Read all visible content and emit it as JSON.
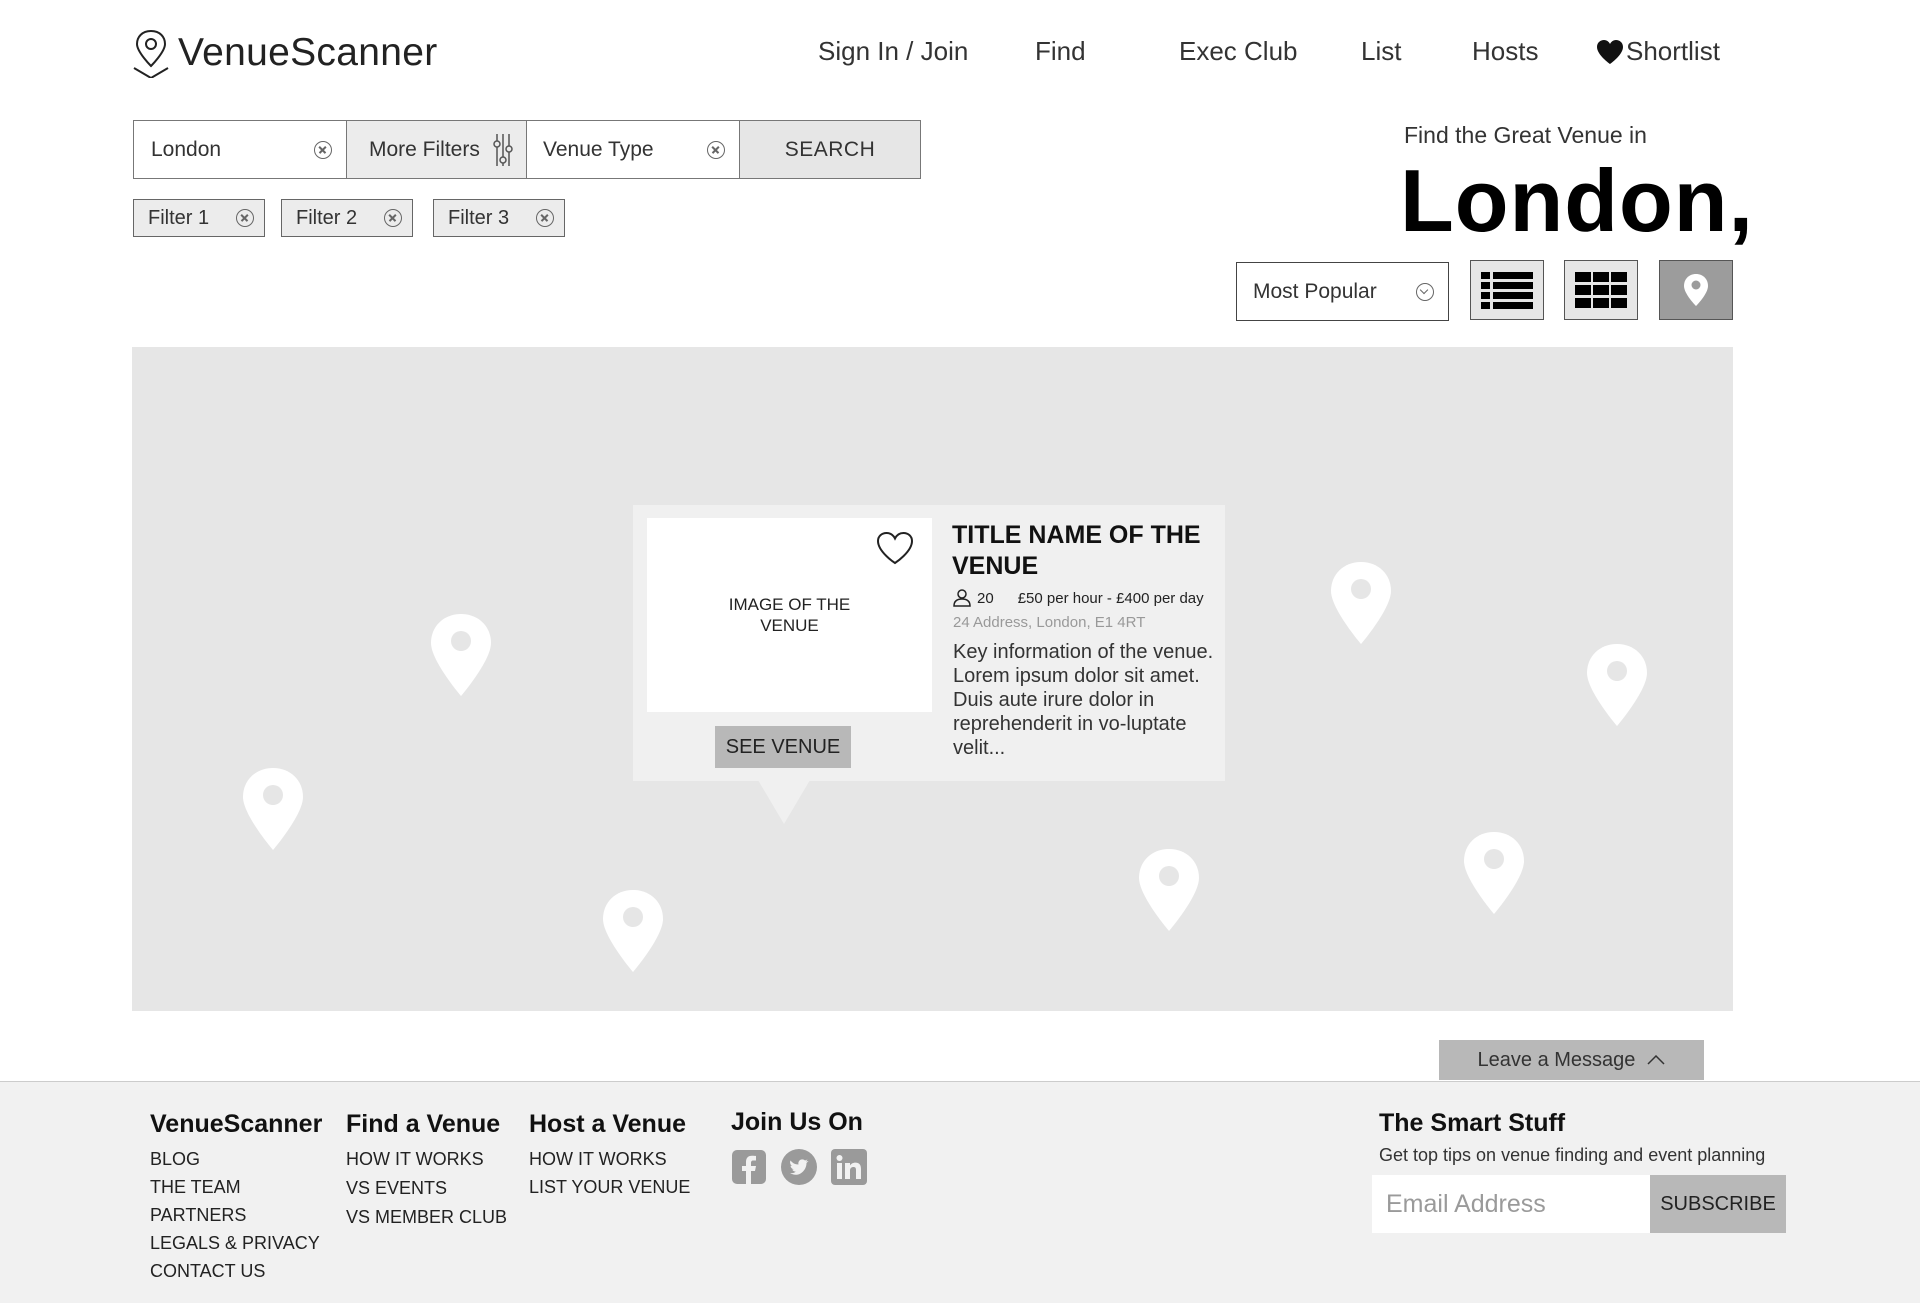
{
  "brand": {
    "name": "VenueScanner",
    "logo_icon": "location-pin-outline-icon"
  },
  "nav": {
    "items": [
      {
        "label": "Sign In / Join"
      },
      {
        "label": "Find"
      },
      {
        "label": "Exec Club"
      },
      {
        "label": "List"
      },
      {
        "label": "Hosts"
      },
      {
        "label": "Shortlist",
        "icon": "heart-icon"
      }
    ]
  },
  "search": {
    "location": "London",
    "more_filters": "More Filters",
    "venue_type": "Venue Type",
    "button": "SEARCH"
  },
  "filters": [
    {
      "label": "Filter 1"
    },
    {
      "label": "Filter 2"
    },
    {
      "label": "Filter 3"
    }
  ],
  "hero": {
    "subtitle": "Find the Great Venue in",
    "city": "London,"
  },
  "sort": {
    "selected": "Most Popular",
    "views": [
      "list-view-icon",
      "grid-view-icon",
      "map-view-icon"
    ],
    "active_view": "map-view-icon"
  },
  "popup": {
    "image_text": "IMAGE OF THE VENUE",
    "button": "SEE VENUE",
    "title": "TITLE NAME OF THE VENUE",
    "capacity": "20",
    "price": "£50 per hour - £400 per day",
    "address": "24 Address, London, E1 4RT",
    "description": "Key information of the venue. Lorem ipsum dolor sit amet. Duis aute irure dolor in reprehenderit in vo-luptate velit..."
  },
  "leave_message": {
    "label": "Leave a Message"
  },
  "footer": {
    "col1": {
      "title": "VenueScanner",
      "links": [
        "BLOG",
        "THE TEAM",
        "PARTNERS",
        "LEGALS & PRIVACY",
        "CONTACT US"
      ]
    },
    "col2": {
      "title": "Find a Venue",
      "links": [
        "HOW IT WORKS",
        "VS EVENTS",
        "VS MEMBER CLUB"
      ]
    },
    "col3": {
      "title": "Host a Venue",
      "links": [
        "HOW IT WORKS",
        "LIST YOUR VENUE"
      ]
    },
    "col4": {
      "title": "Join Us On",
      "social": [
        "facebook-icon",
        "twitter-icon",
        "linkedin-icon"
      ]
    },
    "newsletter": {
      "title": "The Smart Stuff",
      "subtitle": "Get top tips on venue finding and event planning",
      "placeholder": "Email Address",
      "button": "SUBSCRIBE"
    }
  },
  "colors": {
    "map_bg": "#e6e6e6",
    "button_grey": "#b8b8b8",
    "active_view": "#9c9c9c",
    "footer_bg": "#f1f1f1"
  }
}
